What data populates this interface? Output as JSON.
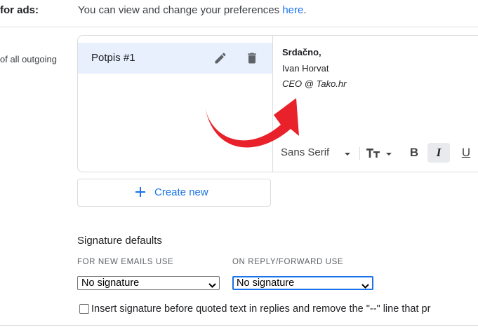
{
  "ads": {
    "label": "for ads:",
    "text": "You can view and change your preferences ",
    "link": "here",
    "after": "."
  },
  "signature_section": {
    "left_label": "of all outgoing"
  },
  "signatures": {
    "items": [
      {
        "name": "Potpis #1",
        "edit_icon": "pencil-icon",
        "delete_icon": "trash-icon"
      }
    ]
  },
  "editor": {
    "line1": "Srdačno,",
    "line2": "Ivan Horvat",
    "line3": "CEO @ Tako.hr",
    "toolbar": {
      "font": "Sans Serif",
      "bold": "B",
      "italic": "I",
      "underline": "U"
    }
  },
  "create_button": {
    "label": "Create new"
  },
  "signature_defaults": {
    "title": "Signature defaults",
    "new_emails_label": "FOR NEW EMAILS USE",
    "new_emails_value": "No signature",
    "reply_label": "ON REPLY/FORWARD USE",
    "reply_value": "No signature",
    "checkbox_label": "Insert signature before quoted text in replies and remove the \"--\" line that pr"
  },
  "colors": {
    "accent": "#1a73e8",
    "selected_bg": "#e8f0fe",
    "arrow": "#e8212a"
  }
}
